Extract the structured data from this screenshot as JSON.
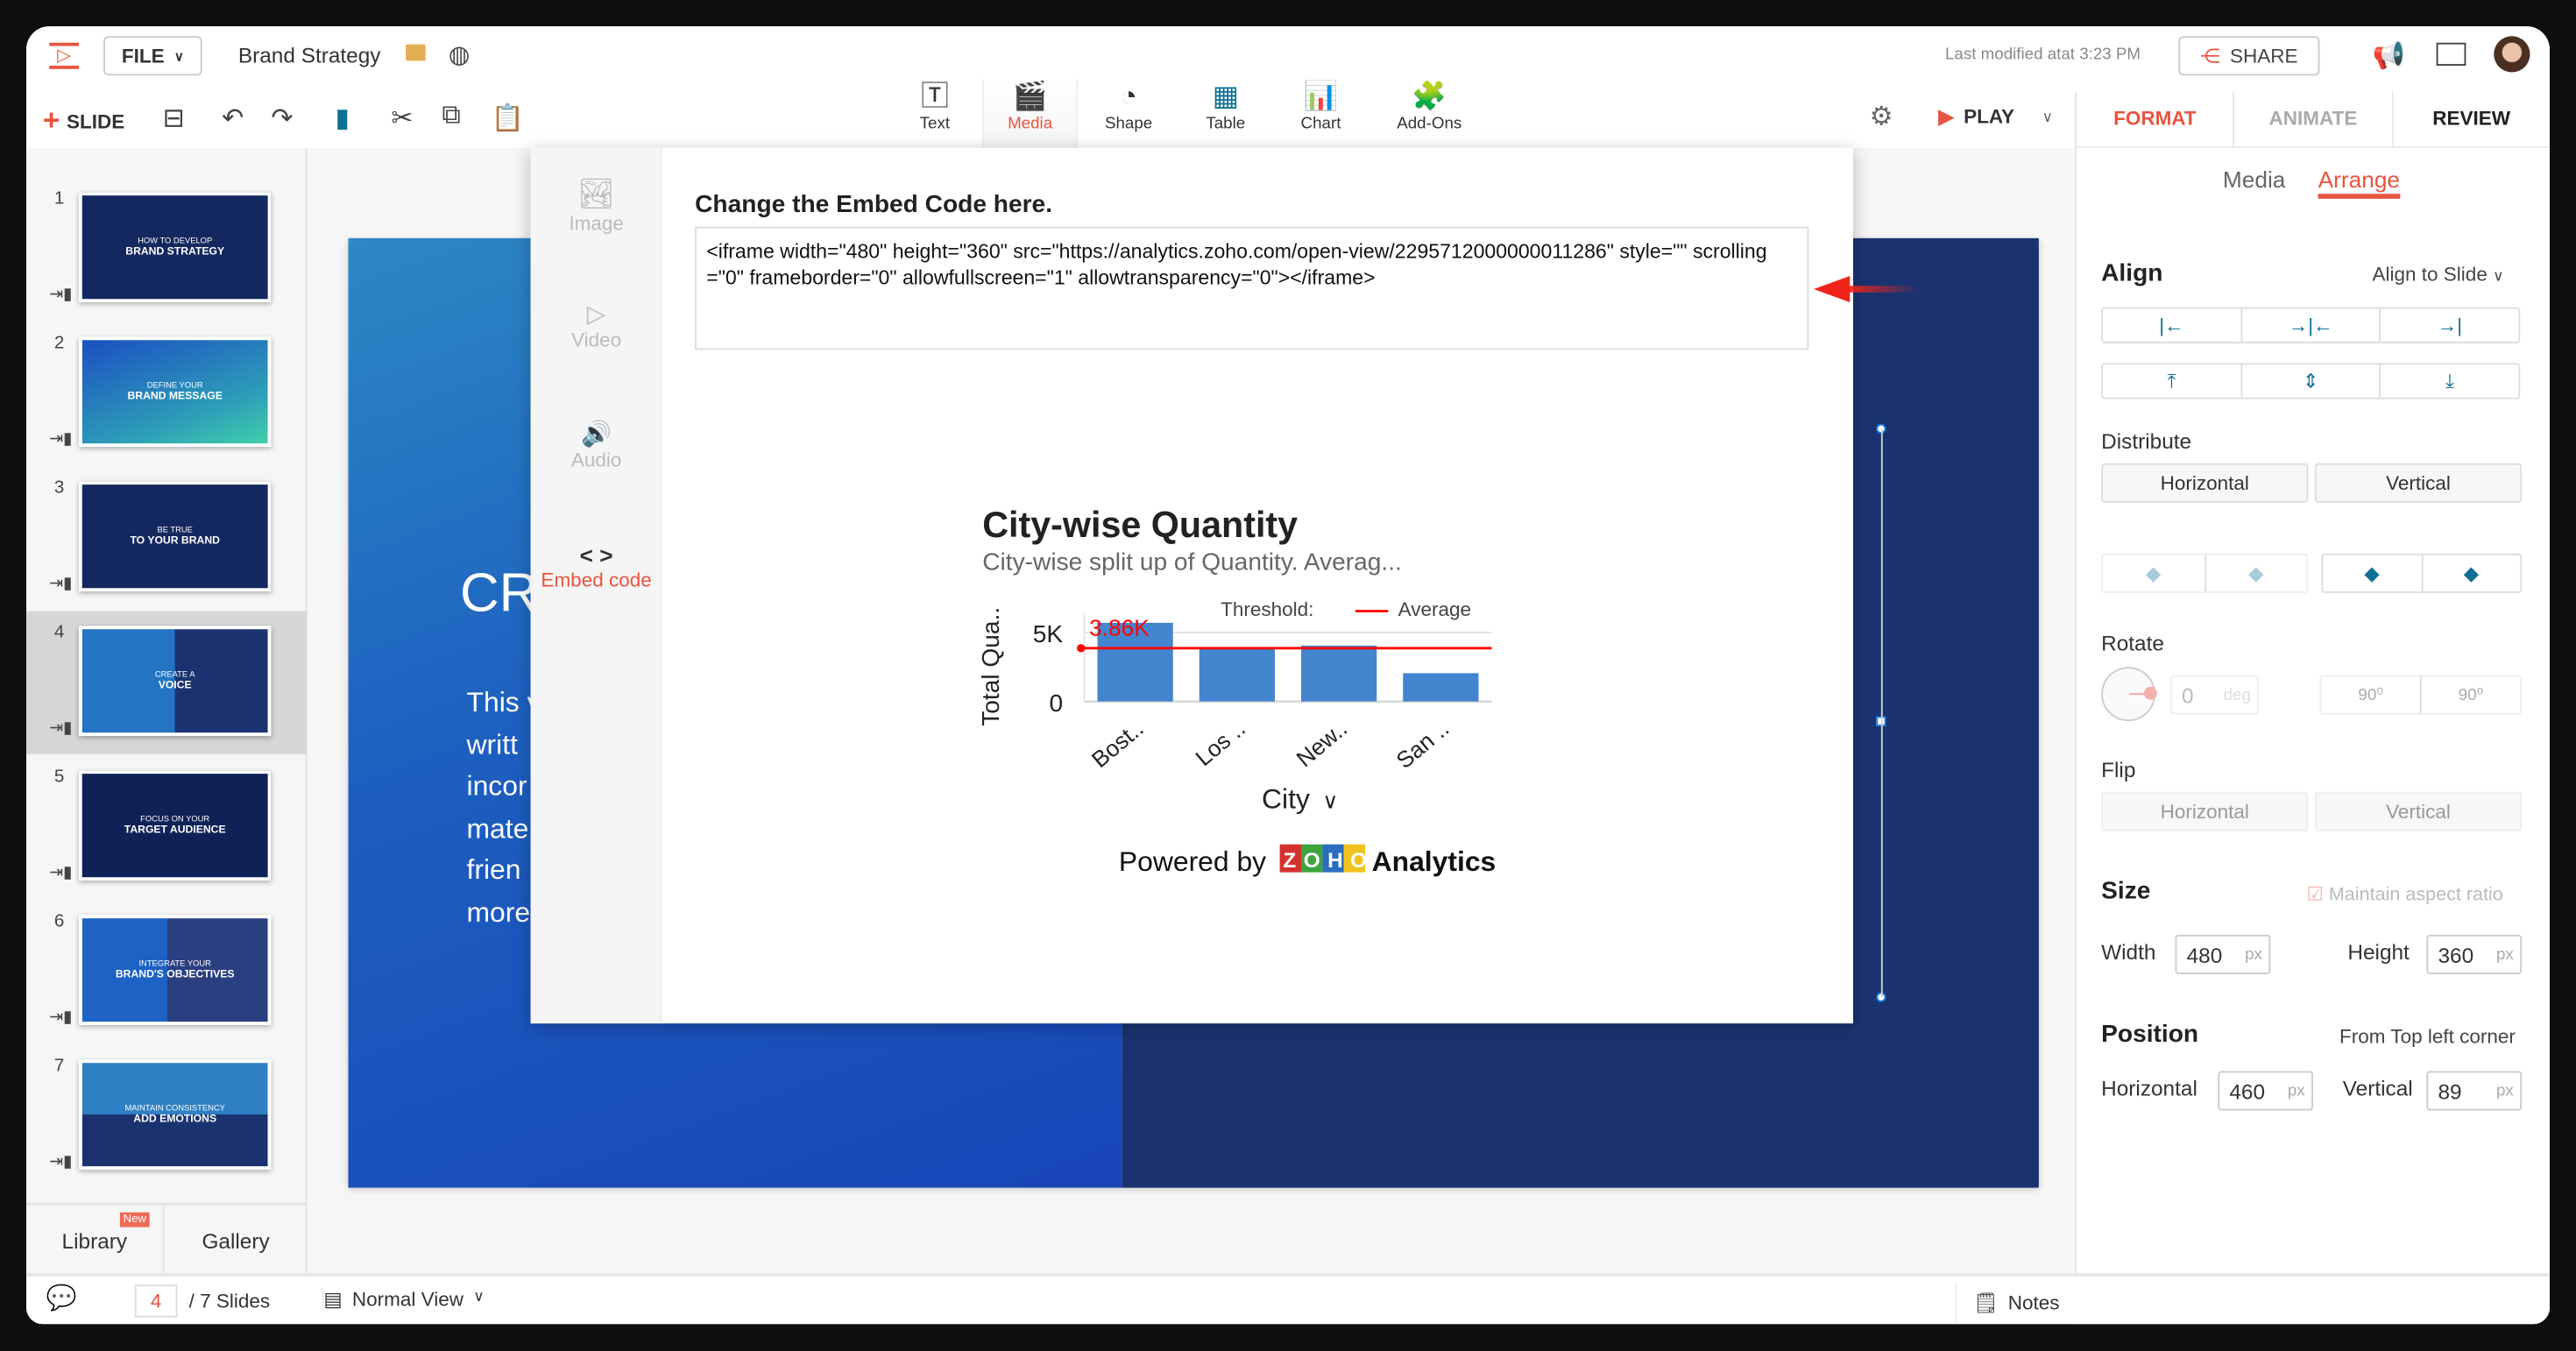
{
  "header": {
    "file_label": "FILE",
    "doc_title": "Brand Strategy",
    "last_modified": "Last modified atat 3:23 PM",
    "share_label": "SHARE"
  },
  "toolbar": {
    "slide_label": "SLIDE",
    "insert": [
      {
        "label": "Text",
        "icon": "text-box-icon"
      },
      {
        "label": "Media",
        "icon": "clapper-icon",
        "active": true
      },
      {
        "label": "Shape",
        "icon": "shape-icon"
      },
      {
        "label": "Table",
        "icon": "table-icon"
      },
      {
        "label": "Chart",
        "icon": "bar-chart-icon"
      },
      {
        "label": "Add-Ons",
        "icon": "puzzle-icon"
      }
    ],
    "play_label": "PLAY"
  },
  "right_tabs": [
    {
      "label": "FORMAT",
      "active": true
    },
    {
      "label": "ANIMATE"
    },
    {
      "label": "REVIEW"
    }
  ],
  "sub_tabs": [
    {
      "label": "Media"
    },
    {
      "label": "Arrange",
      "active": true
    }
  ],
  "arrange": {
    "align_title": "Align",
    "align_to": "Align to Slide",
    "distribute_title": "Distribute",
    "distribute_h": "Horizontal",
    "distribute_v": "Vertical",
    "rotate_title": "Rotate",
    "rotate_value": "0",
    "rotate_unit": "deg",
    "rotate_cw": "90⁰",
    "rotate_ccw": "90⁰",
    "flip_title": "Flip",
    "flip_h": "Horizontal",
    "flip_v": "Vertical",
    "size_title": "Size",
    "maintain_aspect": "Maintain aspect ratio",
    "width_label": "Width",
    "width_value": "480",
    "height_label": "Height",
    "height_value": "360",
    "unit": "px",
    "position_title": "Position",
    "position_from": "From Top left corner",
    "pos_h_label": "Horizontal",
    "pos_h_value": "460",
    "pos_v_label": "Vertical",
    "pos_v_value": "89"
  },
  "slides": [
    {
      "num": "1",
      "line1": "HOW TO DEVELOP",
      "line2": "BRAND STRATEGY"
    },
    {
      "num": "2",
      "line1": "DEFINE YOUR",
      "line2": "BRAND MESSAGE"
    },
    {
      "num": "3",
      "line1": "BE TRUE",
      "line2": "TO YOUR BRAND"
    },
    {
      "num": "4",
      "line1": "CREATE A",
      "line2": "VOICE"
    },
    {
      "num": "5",
      "line1": "FOCUS ON YOUR",
      "line2": "TARGET AUDIENCE"
    },
    {
      "num": "6",
      "line1": "INTEGRATE YOUR",
      "line2": "BRAND'S OBJECTIVES"
    },
    {
      "num": "7",
      "line1": "MAINTAIN CONSISTENCY",
      "line2": "ADD EMOTIONS"
    }
  ],
  "left_footer": {
    "library": "Library",
    "new_badge": "New",
    "gallery": "Gallery"
  },
  "slide_content": {
    "heading": "CR",
    "body": [
      "This v",
      "writt",
      "incor",
      "mate",
      "frien",
      "more"
    ]
  },
  "dialog": {
    "nav": [
      {
        "label": "Image"
      },
      {
        "label": "Video"
      },
      {
        "label": "Audio"
      },
      {
        "label": "Embed code",
        "active": true
      }
    ],
    "title": "Change the Embed Code here.",
    "embed_code": "<iframe width=\"480\" height=\"360\" src=\"https://analytics.zoho.com/open-view/2295712000000011286\" style=\"\" scrolling=\"0\" frameborder=\"0\" allowfullscreen=\"1\" allowtransparency=\"0\"></iframe>",
    "powered_by": "Powered by",
    "brand": "ZOHO",
    "product": "Analytics"
  },
  "chart_data": {
    "type": "bar",
    "title": "City-wise Quantity",
    "subtitle": "City-wise split up of Quantity. Averag...",
    "xlabel": "City",
    "ylabel": "Total Qua..",
    "categories": [
      "Bost..",
      "Los ..",
      "New..",
      "San .."
    ],
    "values": [
      5700,
      3800,
      4050,
      2050
    ],
    "yticks": [
      "0",
      "5K"
    ],
    "ylim": [
      0,
      5000
    ],
    "threshold": {
      "legend": "Threshold:",
      "name": "Average",
      "value": 3860,
      "label": "3.86K",
      "color": "#ff0000"
    },
    "bar_color": "#4485cf",
    "grid": true
  },
  "bottom": {
    "current_slide": "4",
    "total": "/ 7 Slides",
    "view": "Normal View",
    "notes": "Notes"
  },
  "colors": {
    "accent": "#e8543f",
    "teal": "#0e7095"
  }
}
